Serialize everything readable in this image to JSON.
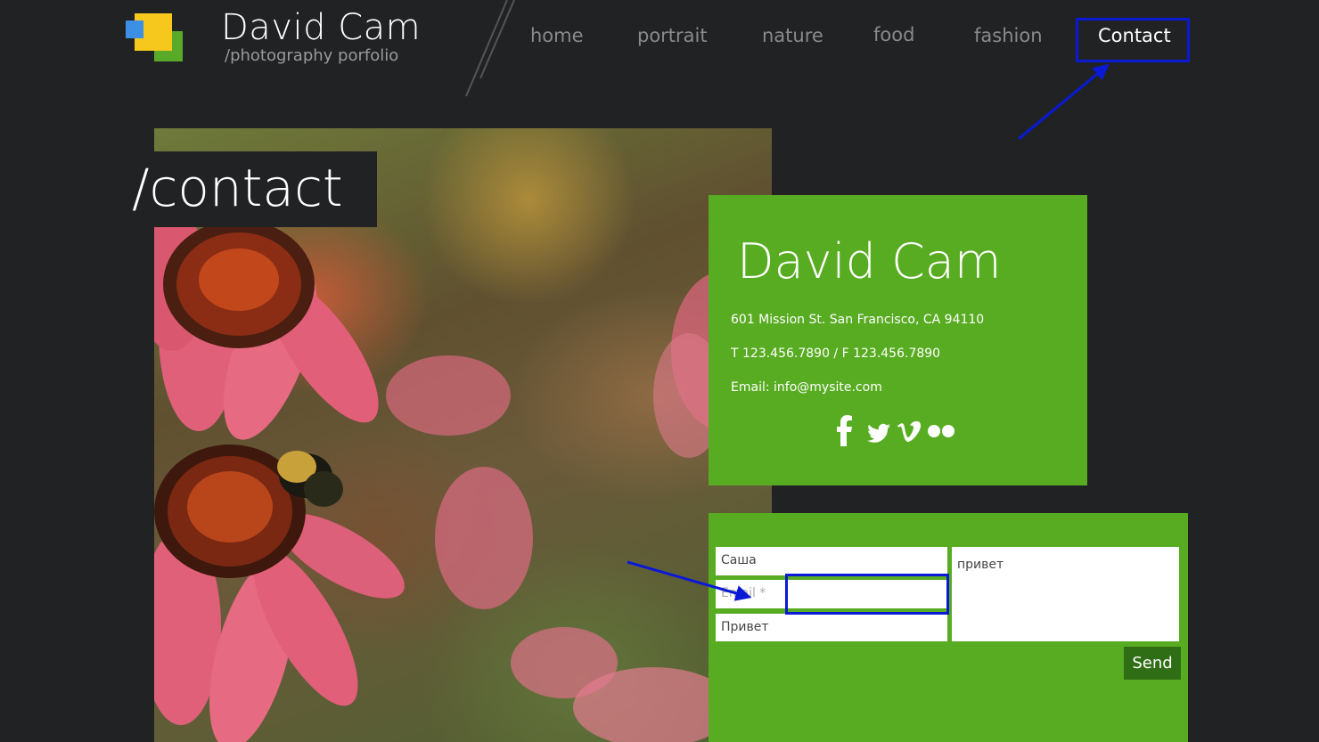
{
  "header": {
    "title": "David Cam",
    "subtitle": "/photography porfolio"
  },
  "nav": {
    "items": [
      {
        "label": "home"
      },
      {
        "label": "portrait"
      },
      {
        "label": "nature"
      },
      {
        "label": "food"
      },
      {
        "label": "fashion"
      },
      {
        "label": "Contact"
      }
    ],
    "active": "Contact"
  },
  "page": {
    "heading": "/contact"
  },
  "info": {
    "name": "David Cam",
    "address": "601 Mission St. San Francisco, CA 94110",
    "phone": "T  123.456.7890  /    F  123.456.7890",
    "email": "Email: info@mysite.com",
    "social": [
      "facebook-icon",
      "twitter-icon",
      "vimeo-icon",
      "flickr-icon"
    ]
  },
  "form": {
    "name_value": "Саша",
    "email_placeholder": "Email *",
    "subject_value": "Привет",
    "message_value": "привет",
    "send_label": "Send"
  },
  "colors": {
    "background": "#212224",
    "accent_green": "#58ac22",
    "send_button": "#2f6e14",
    "highlight": "#0a19d6"
  }
}
